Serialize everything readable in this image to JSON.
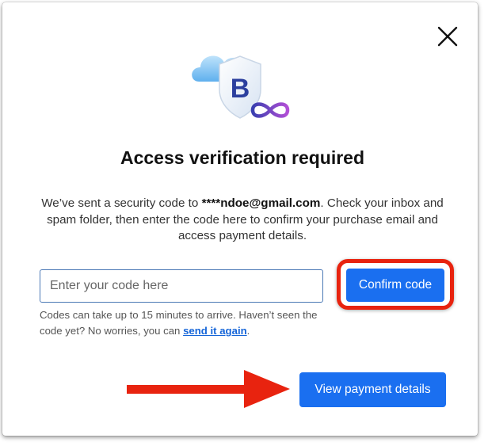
{
  "dialog": {
    "logo_icon": "cloud-shield-b-infinity-logo",
    "close_icon": "close-icon",
    "title": "Access verification required",
    "description": {
      "prefix": "We’ve sent a security code to ",
      "email": "****ndoe@gmail.com",
      "suffix": ". Check your inbox and spam folder, then enter the code here to confirm your purchase email and access payment details."
    },
    "code_input": {
      "placeholder": "Enter your code here",
      "value": ""
    },
    "confirm_button_label": "Confirm code",
    "hint": {
      "text": "Codes can take up to 15 minutes to arrive. Haven’t seen the code yet? No worries, you can ",
      "link_label": "send it again",
      "suffix": "."
    },
    "view_payment_button_label": "View payment details"
  },
  "colors": {
    "primary_button": "#1a6ff0",
    "annotation_red": "#e8230f",
    "link": "#1565d8"
  }
}
